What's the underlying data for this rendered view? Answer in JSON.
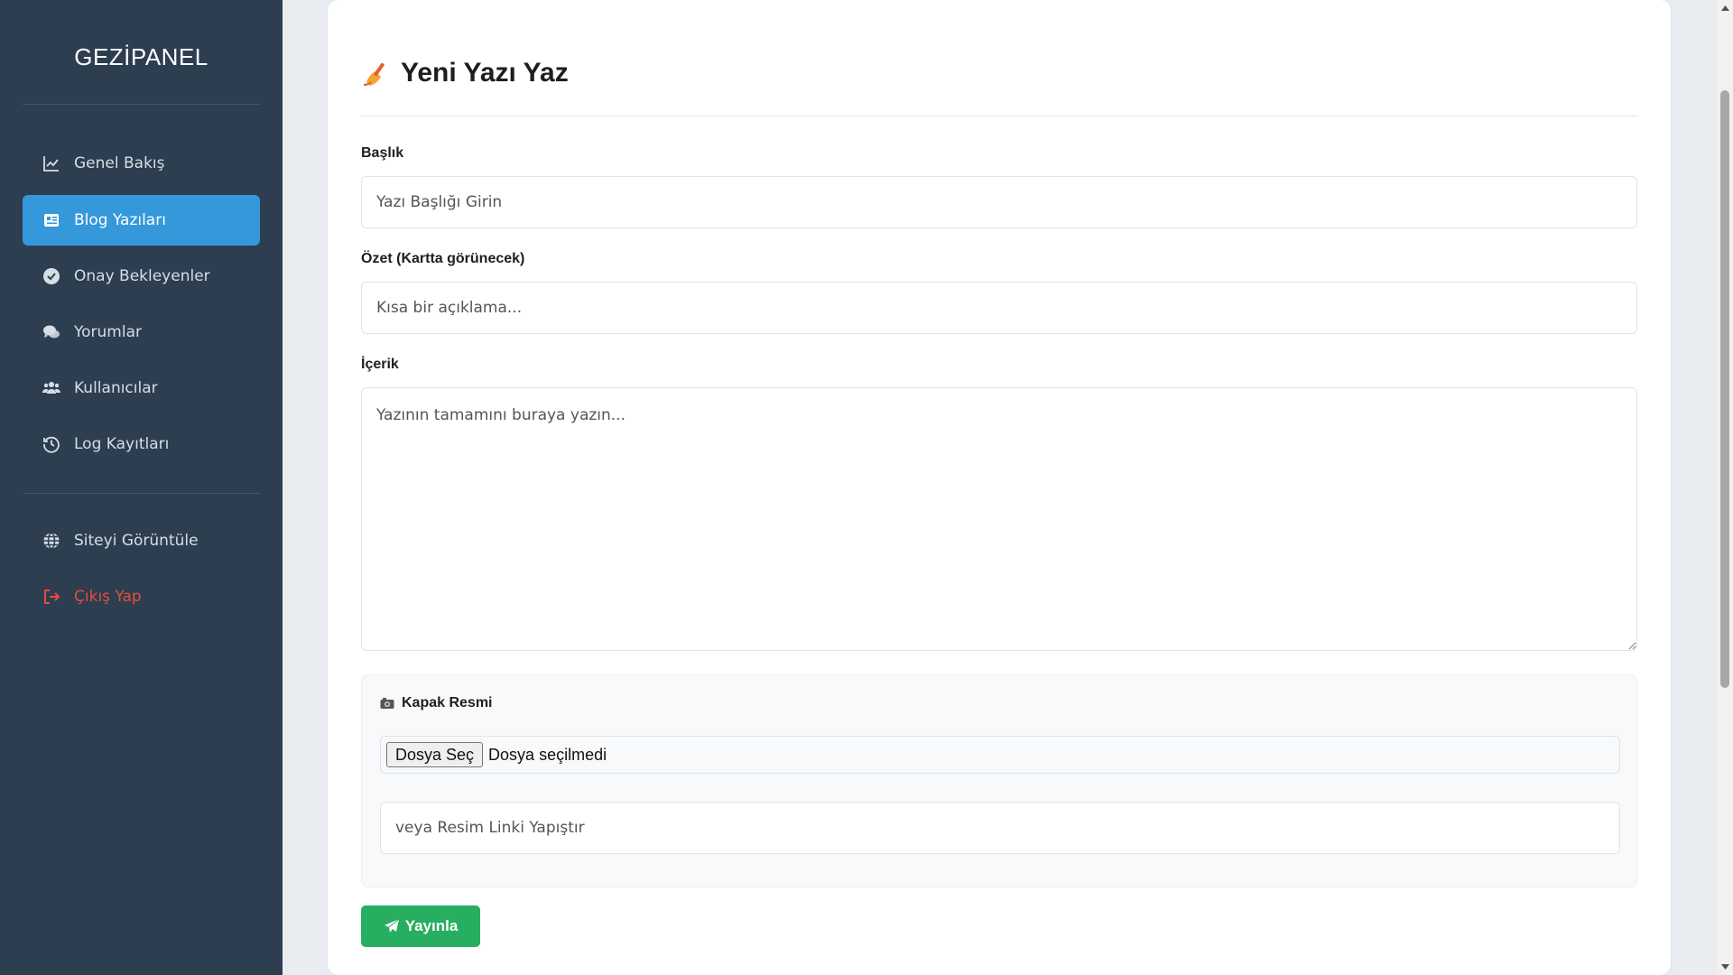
{
  "sidebar": {
    "brand": "GEZİPANEL",
    "items": [
      {
        "label": "Genel Bakış",
        "icon": "chart-line-icon"
      },
      {
        "label": "Blog Yazıları",
        "icon": "newspaper-icon",
        "active": true
      },
      {
        "label": "Onay Bekleyenler",
        "icon": "check-circle-icon"
      },
      {
        "label": "Yorumlar",
        "icon": "comments-icon"
      },
      {
        "label": "Kullanıcılar",
        "icon": "users-icon"
      },
      {
        "label": "Log Kayıtları",
        "icon": "history-icon"
      }
    ],
    "secondary": [
      {
        "label": "Siteyi Görüntüle",
        "icon": "globe-icon"
      },
      {
        "label": "Çıkış Yap",
        "icon": "sign-out-icon",
        "color": "#e74c3c"
      }
    ]
  },
  "form": {
    "title": "Yeni Yazı Yaz",
    "title_icon": "writing-hand-icon",
    "title_label": "Başlık",
    "title_placeholder": "Yazı Başlığı Girin",
    "summary_label": "Özet (Kartta görünecek)",
    "summary_placeholder": "Kısa bir açıklama...",
    "content_label": "İçerik",
    "content_placeholder": "Yazının tamamını buraya yazın...",
    "cover": {
      "label": "Kapak Resmi",
      "icon": "camera-icon",
      "file_button": "Dosya Seç",
      "file_status": "Dosya seçilmedi",
      "url_placeholder": "veya Resim Linki Yapıştır"
    },
    "publish_label": "Yayınla"
  },
  "colors": {
    "sidebar_bg": "#2c3e50",
    "active": "#3498db",
    "publish": "#27ae60",
    "logout": "#e74c3c"
  }
}
